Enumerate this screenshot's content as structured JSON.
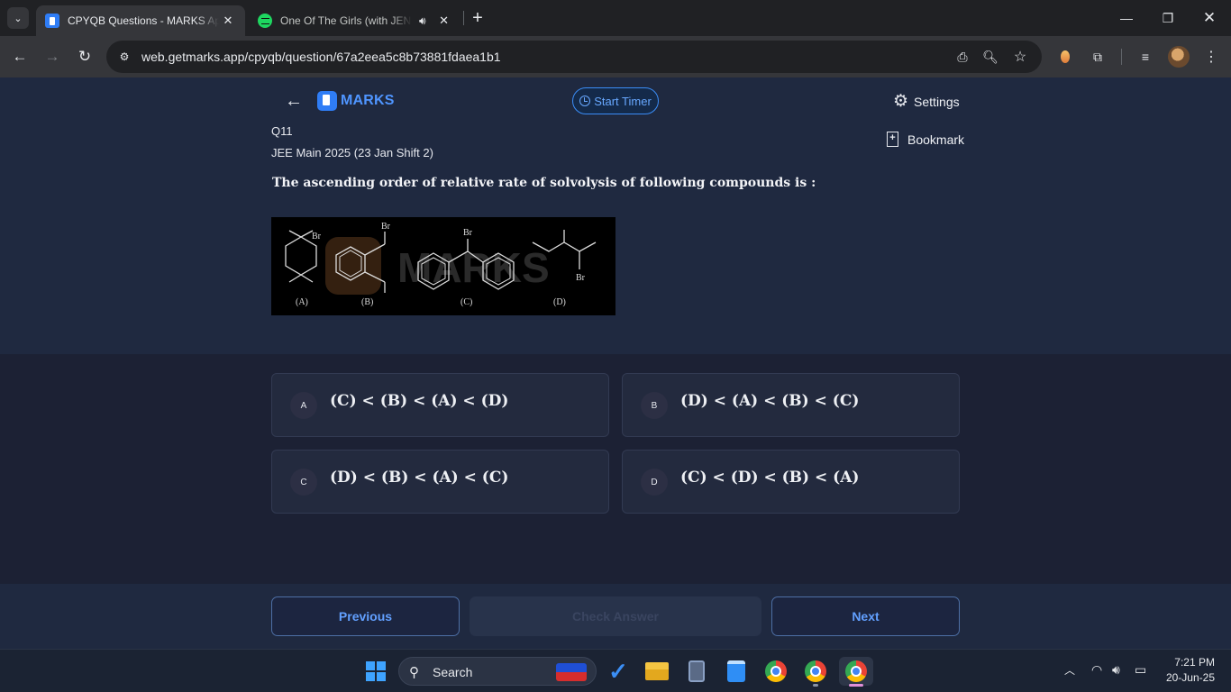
{
  "browser": {
    "tabs": [
      {
        "title": "CPYQB Questions - MARKS App",
        "active": true
      },
      {
        "title": "One Of The Girls (with JENNIE",
        "active": false
      }
    ],
    "url": "web.getmarks.app/cpyqb/question/67a2eea5c8b73881fdaea1b1"
  },
  "header": {
    "brand": "MARKS",
    "start_timer": "Start Timer",
    "settings": "Settings",
    "bookmark": "Bookmark"
  },
  "question": {
    "number": "Q11",
    "source": "JEE Main 2025 (23 Jan Shift 2)",
    "text": "The ascending order of relative rate of solvolysis of following compounds is :",
    "image": {
      "br_label": "Br",
      "labels": [
        "(A)",
        "(B)",
        "(C)",
        "(D)"
      ],
      "watermark": "MARKS"
    }
  },
  "options": [
    {
      "letter": "A",
      "text": "(C) < (B) < (A) < (D)"
    },
    {
      "letter": "B",
      "text": "(D) < (A) < (B) < (C)"
    },
    {
      "letter": "C",
      "text": "(D) < (B) < (A) < (C)"
    },
    {
      "letter": "D",
      "text": "(C) < (D) < (B) < (A)"
    }
  ],
  "footer": {
    "previous": "Previous",
    "check_answer": "Check Answer",
    "next": "Next"
  },
  "taskbar": {
    "search": "Search",
    "time": "7:21 PM",
    "date": "20-Jun-25"
  }
}
